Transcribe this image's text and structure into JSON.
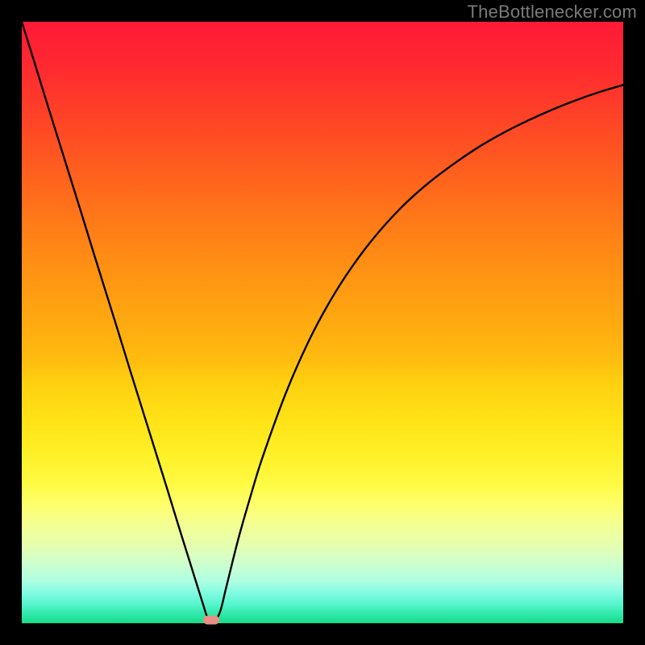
{
  "watermark": "TheBottlenecker.com",
  "chart_data": {
    "type": "line",
    "title": "",
    "xlabel": "",
    "ylabel": "",
    "xlim": [
      0,
      100
    ],
    "ylim": [
      0,
      100
    ],
    "grid": false,
    "series": [
      {
        "name": "bottleneck-curve",
        "x": [
          0,
          2,
          4,
          6,
          8,
          10,
          12,
          14,
          16,
          18,
          20,
          22,
          24,
          26,
          28,
          30,
          31,
          32,
          33,
          34,
          36,
          38,
          40,
          44,
          48,
          52,
          56,
          60,
          64,
          68,
          72,
          76,
          80,
          84,
          88,
          92,
          96,
          100
        ],
        "y": [
          100,
          93.6,
          87.1,
          80.7,
          74.3,
          67.9,
          61.4,
          55.0,
          48.6,
          42.1,
          35.7,
          29.3,
          22.9,
          16.4,
          10.0,
          3.6,
          0.7,
          0.3,
          2.0,
          6.0,
          14.0,
          21.0,
          27.5,
          38.5,
          47.5,
          54.8,
          60.8,
          65.8,
          70.0,
          73.5,
          76.5,
          79.2,
          81.5,
          83.5,
          85.3,
          86.9,
          88.3,
          89.5
        ]
      }
    ],
    "marker": {
      "x": 31.5,
      "y": 0.5,
      "name": "optimal-point"
    },
    "background_gradient": {
      "top": "#ff1937",
      "mid": "#fff028",
      "bottom": "#16db88"
    }
  }
}
